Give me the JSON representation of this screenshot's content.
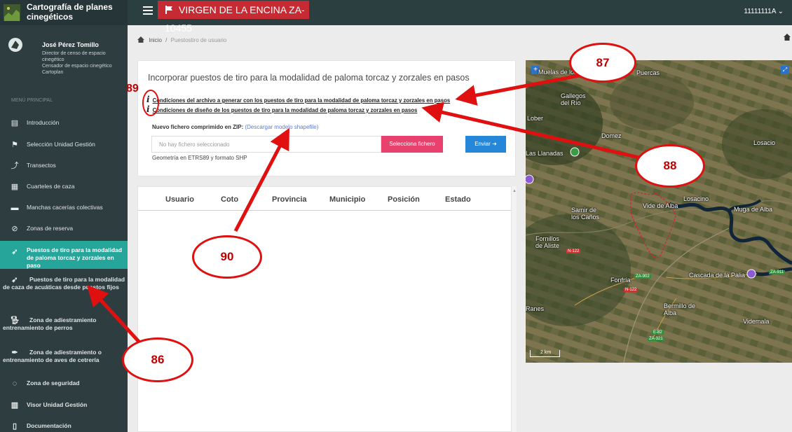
{
  "header": {
    "app_title": "Cartografía de planes cinegéticos",
    "coto_name": "VIRGEN DE LA ENCINA ZA-10455",
    "user_id": "11111111A ⌄"
  },
  "profile": {
    "name": "José Pérez Tomillo",
    "role": "Director de censo de espacio cinegético\nCensador de espacio cinegético\nCartoplan"
  },
  "sidebar": {
    "menu_title": "MENÚ PRINCIPAL",
    "items": [
      {
        "label": "Introducción",
        "icon": "document-icon"
      },
      {
        "label": "Selección Unidad Gestión",
        "icon": "flag-icon"
      },
      {
        "label": "Transectos",
        "icon": "trend-icon"
      },
      {
        "label": "Cuarteles de caza",
        "icon": "grid-icon"
      },
      {
        "label": "Manchas cacerías colectivas",
        "icon": "boar-icon"
      },
      {
        "label": "Zonas de reserva",
        "icon": "prohibited-icon"
      },
      {
        "label": "Puestos de tiro para la modalidad de paloma torcaz y zorzales en paso",
        "icon": "bird-icon"
      },
      {
        "label": "Puestos de tiro para la modalidad de caza de acuáticas desde puestos fijos",
        "icon": "duck-icon"
      },
      {
        "label": "Zona de adiestramiento entrenamiento de perros",
        "icon": "dog-icon"
      },
      {
        "label": "Zona de adiestramiento o entrenamiento de aves de cetrería",
        "icon": "feather-icon"
      },
      {
        "label": "Zona de seguridad",
        "icon": "check-circle-icon"
      },
      {
        "label": "Visor Unidad Gestión",
        "icon": "map-icon"
      },
      {
        "label": "Documentación",
        "icon": "file-icon"
      }
    ]
  },
  "breadcrumb": {
    "home": "Inicio",
    "separator": "/",
    "current": "Puestostiro de usuario"
  },
  "upload": {
    "title": "Incorporar puestos de tiro para la modalidad de paloma torcaz y zorzales en pasos",
    "info_links": [
      "Condiciones del archivo a generar con los puestos de tiro para la modalidad de paloma torcaz y zorzales en pasos",
      "Condiciones de diseño de los puestos de tiro para la modalidad de paloma torcaz y zorzales en pasos"
    ],
    "zip_label": "Nuevo fichero comprimido en ZIP:",
    "download_link": "(Descargar modelo shapefile)",
    "file_placeholder": "No hay fichero seleccionado",
    "select_button": "Selecciona fichero",
    "send_button": "Enviar ➜",
    "geometry_note": "Geometría en ETRS89 y formato SHP"
  },
  "table": {
    "columns": [
      "Usuario",
      "Coto",
      "Provincia",
      "Municipio",
      "Posición",
      "Estado"
    ]
  },
  "map": {
    "places": [
      "Muelas de los Caballeros",
      "Puercas",
      "Gallegos del Río",
      "Lober",
      "Domez",
      "Losacio",
      "Las Llanadas",
      "Losacino",
      "Vide de Alba",
      "Samir de los Caños",
      "Muga de Alba",
      "Fornillos de Aliste",
      "Fonfría",
      "Cascada de la Palia",
      "Bermillo de Alba",
      "Videmala",
      "Ranes"
    ],
    "roads": [
      "N-122",
      "ZA-902",
      "ZA-911",
      "ZA-321",
      "E-82"
    ],
    "scale": "2 km"
  },
  "annotations": {
    "c86": "86",
    "c87": "87",
    "c88": "88",
    "c89": "89",
    "c90": "90"
  },
  "colors": {
    "accent": "#26a69a",
    "brand_red": "#c62a33",
    "select": "#e8416e",
    "send": "#2487d8",
    "annotation": "#e01010"
  }
}
